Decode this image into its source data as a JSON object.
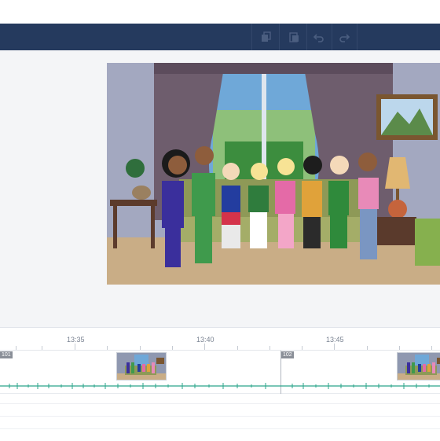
{
  "toolbar": {
    "buttons": [
      {
        "name": "copy-icon",
        "glyph": "⧉"
      },
      {
        "name": "paste-icon",
        "glyph": "❐"
      },
      {
        "name": "undo-icon",
        "glyph": "↶"
      },
      {
        "name": "redo-icon",
        "glyph": "↷"
      }
    ]
  },
  "timeline": {
    "ticks": [
      "13:35",
      "13:40",
      "13:45"
    ],
    "scenes": [
      "101",
      "102"
    ]
  },
  "colors": {
    "toolbar_bg": "#253a5e",
    "waveform": "#2aa58a",
    "scene_label_bg": "#8a8f98"
  }
}
